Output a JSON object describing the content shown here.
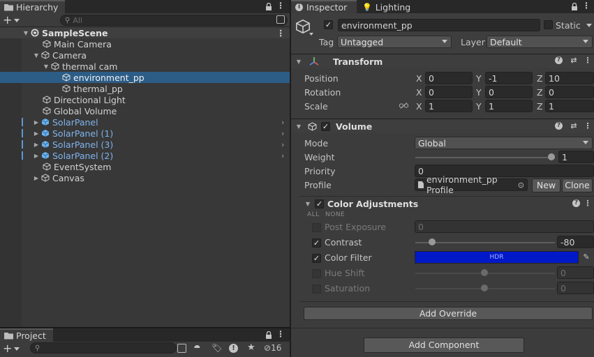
{
  "hierarchy": {
    "tab_label": "Hierarchy",
    "search_placeholder": "All",
    "rows": [
      {
        "label": "SampleScene"
      },
      {
        "label": "Main Camera"
      },
      {
        "label": "Camera"
      },
      {
        "label": "thermal cam"
      },
      {
        "label": "environment_pp"
      },
      {
        "label": "thermal_pp"
      },
      {
        "label": "Directional Light"
      },
      {
        "label": "Global Volume"
      },
      {
        "label": "SolarPanel"
      },
      {
        "label": "SolarPanel (1)"
      },
      {
        "label": "SolarPanel (3)"
      },
      {
        "label": "SolarPanel (2)"
      },
      {
        "label": "EventSystem"
      },
      {
        "label": "Canvas"
      }
    ]
  },
  "project": {
    "tab_label": "Project",
    "hidden_count": "16"
  },
  "inspector": {
    "tabs": [
      {
        "label": "Inspector"
      },
      {
        "label": "Lighting"
      }
    ],
    "object_name": "environment_pp",
    "static_label": "Static",
    "tag_label": "Tag",
    "tag_value": "Untagged",
    "layer_label": "Layer",
    "layer_value": "Default",
    "transform": {
      "title": "Transform",
      "position_label": "Position",
      "rotation_label": "Rotation",
      "scale_label": "Scale",
      "axis_x": "X",
      "axis_y": "Y",
      "axis_z": "Z",
      "position": {
        "x": "0",
        "y": "-1",
        "z": "10"
      },
      "rotation": {
        "x": "0",
        "y": "0",
        "z": "0"
      },
      "scale": {
        "x": "1",
        "y": "1",
        "z": "1"
      }
    },
    "volume": {
      "title": "Volume",
      "mode_label": "Mode",
      "mode_value": "Global",
      "weight_label": "Weight",
      "weight_value": "1",
      "weight_fraction": 1.0,
      "priority_label": "Priority",
      "priority_value": "0",
      "profile_label": "Profile",
      "profile_value": "environment_pp Profile",
      "new_label": "New",
      "clone_label": "Clone"
    },
    "color_adjustments": {
      "title": "Color Adjustments",
      "all_label": "ALL",
      "none_label": "NONE",
      "post_exposure_label": "Post Exposure",
      "post_exposure_value": "0",
      "contrast_label": "Contrast",
      "contrast_value": "-80",
      "color_filter_label": "Color Filter",
      "color_filter_hdr": "HDR",
      "color_filter_color": "#0019c8",
      "hue_shift_label": "Hue Shift",
      "hue_shift_value": "0",
      "saturation_label": "Saturation",
      "saturation_value": "0"
    },
    "add_override_label": "Add Override",
    "add_component_label": "Add Component"
  }
}
